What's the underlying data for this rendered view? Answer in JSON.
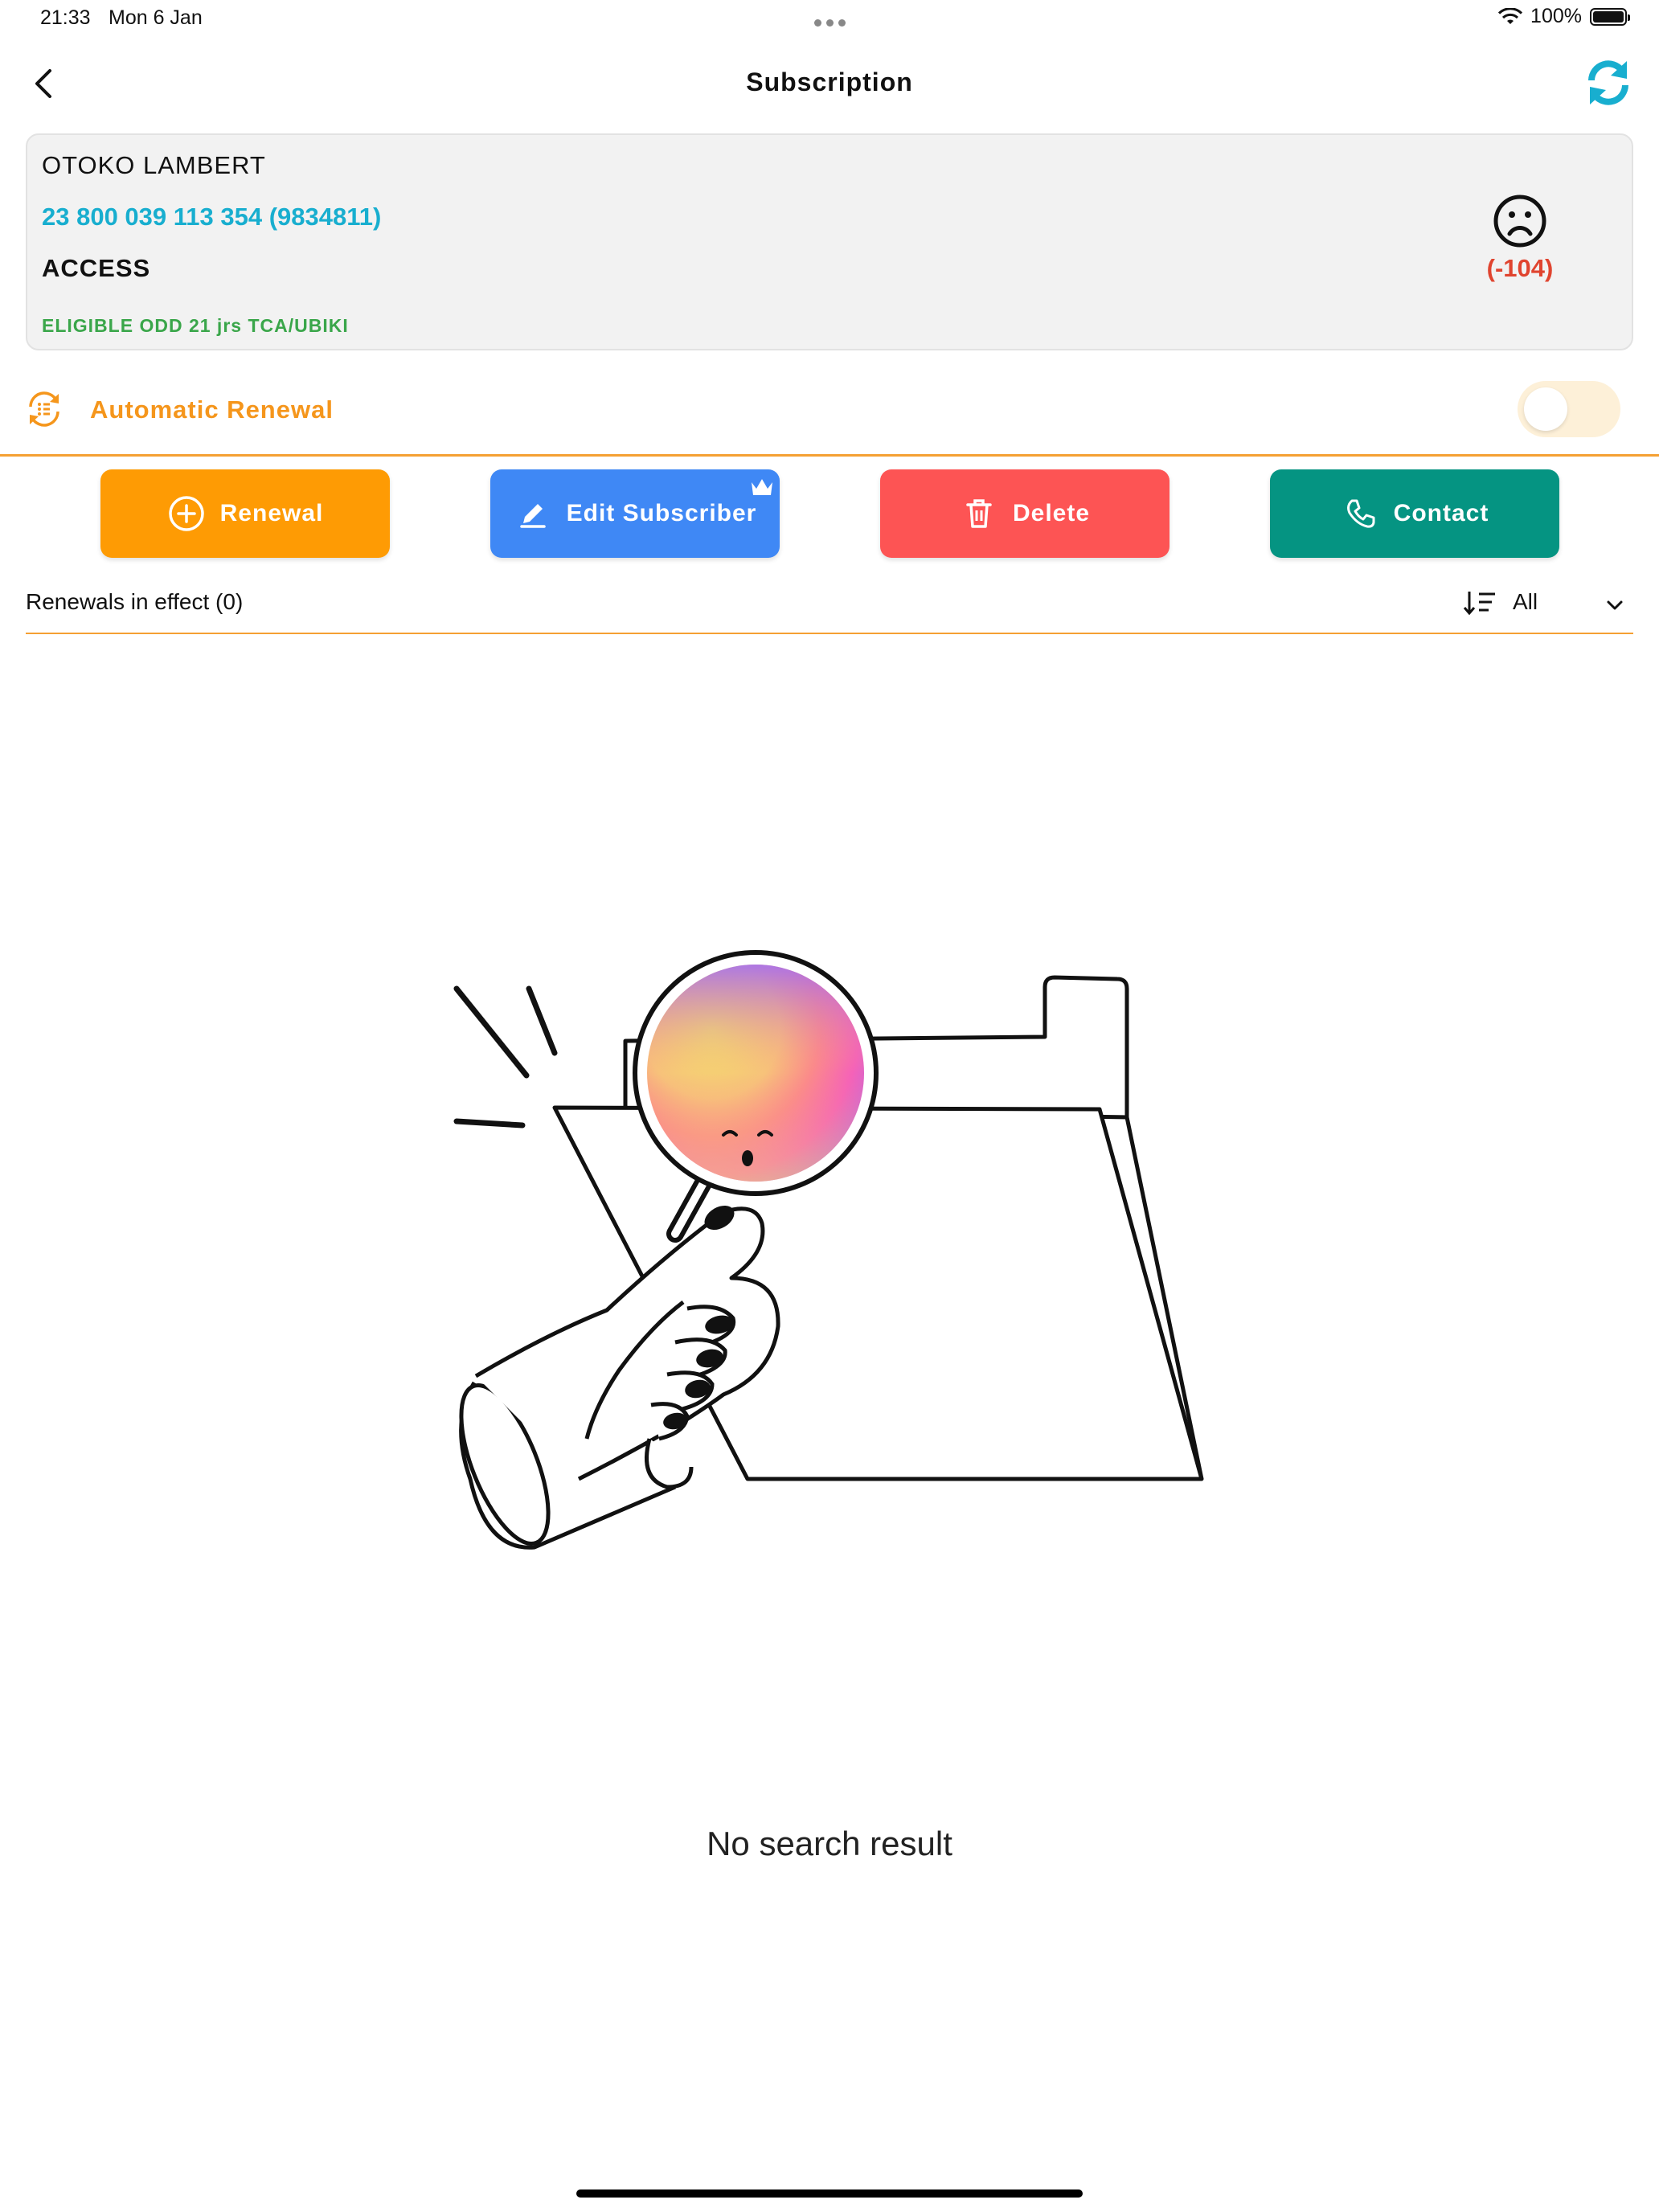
{
  "status_bar": {
    "time": "21:33",
    "date": "Mon 6 Jan",
    "battery": "100%"
  },
  "nav": {
    "title": "Subscription"
  },
  "subscriber": {
    "name": "OTOKO LAMBERT",
    "number": "23 800 039 113 354 (9834811)",
    "offer": "ACCESS",
    "eligibility": "ELIGIBLE ODD 21 jrs TCA/UBIKI",
    "days": "(-104)",
    "status_icon": "sad-face-icon"
  },
  "auto_renewal": {
    "label": "Automatic Renewal",
    "enabled": false
  },
  "actions": {
    "renewal": "Renewal",
    "edit": "Edit Subscriber",
    "delete": "Delete",
    "contact": "Contact"
  },
  "list": {
    "header": "Renewals in effect (0)",
    "filter": "All",
    "empty_message": "No search result"
  },
  "colors": {
    "orange": "#fe9b04",
    "blue": "#3f88f5",
    "red": "#fd5454",
    "teal": "#059482",
    "cyan": "#18aecf",
    "green": "#3aa64a"
  }
}
